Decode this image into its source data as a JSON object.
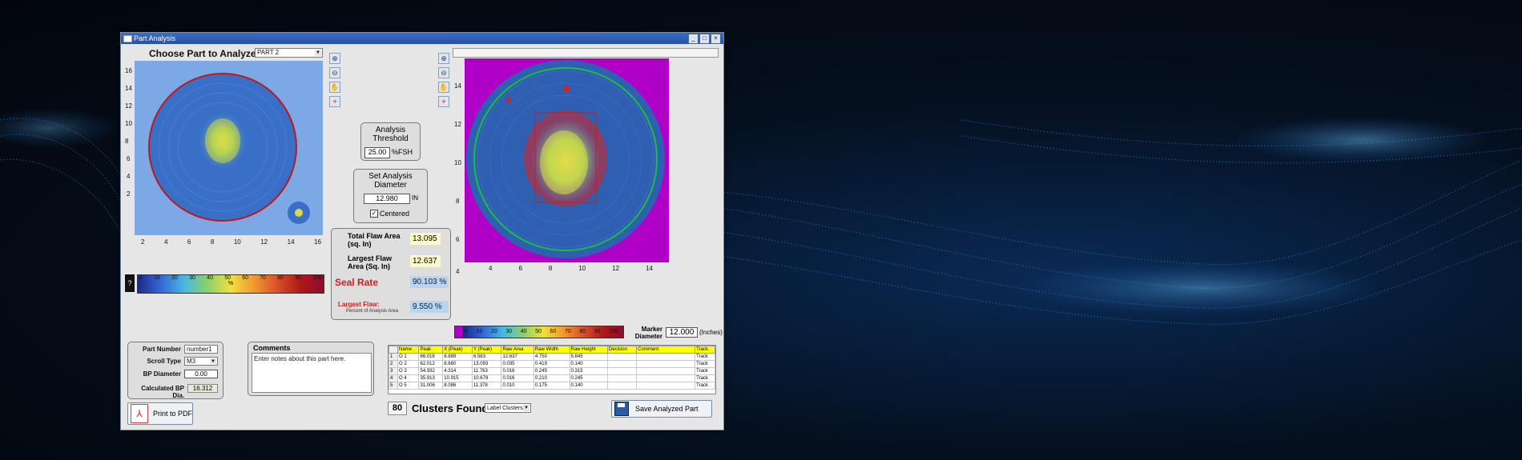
{
  "window": {
    "title": "Part Analysis"
  },
  "chooser": {
    "label": "Choose Part to Analyze:",
    "value": "PART 2"
  },
  "left_plot": {
    "y_ticks": [
      "16",
      "14",
      "12",
      "10",
      "8",
      "6",
      "4",
      "2"
    ],
    "x_ticks": [
      "2",
      "4",
      "6",
      "8",
      "10",
      "12",
      "14",
      "16"
    ]
  },
  "right_plot": {
    "y_ticks": [
      "14",
      "12",
      "10",
      "8",
      "6",
      "4"
    ],
    "x_ticks": [
      "4",
      "6",
      "8",
      "10",
      "12",
      "14"
    ]
  },
  "left_scale": {
    "help": "?",
    "ticks": [
      "0",
      "10",
      "20",
      "30",
      "40",
      "50",
      "60",
      "70",
      "80",
      "90",
      "100"
    ],
    "unit": "%"
  },
  "right_scale": {
    "ticks": [
      "0",
      "10",
      "20",
      "30",
      "40",
      "50",
      "60",
      "70",
      "80",
      "90",
      "100"
    ]
  },
  "threshold": {
    "title": "Analysis Threshold",
    "value": "25.00",
    "unit": "%FSH"
  },
  "diameter": {
    "title": "Set Analysis Diameter",
    "value": "12.980",
    "unit": "IN",
    "centered_label": "Centered",
    "centered_checked": true
  },
  "results": {
    "total_flaw_label": "Total Flaw Area (sq. In)",
    "total_flaw_value": "13.095",
    "largest_flaw_label": "Largest Flaw Area (Sq. In)",
    "largest_flaw_value": "12.637",
    "seal_rate_label": "Seal Rate",
    "seal_rate_value": "90.103 %",
    "largest_pct_label": "Largest Flaw:",
    "largest_pct_sub": "Percent of Analysis Area",
    "largest_pct_value": "9.550 %"
  },
  "marker": {
    "label": "Marker Diameter",
    "value": "12.000",
    "unit": "(Inches)"
  },
  "part_info": {
    "part_number_label": "Part Number",
    "part_number_value": "number1",
    "scroll_type_label": "Scroll Type",
    "scroll_type_value": "M3",
    "bp_diameter_label": "BP Diameter",
    "bp_diameter_value": "0.00",
    "calc_bp_label": "Calculated BP Dia.",
    "calc_bp_value": "16.312"
  },
  "comments": {
    "title": "Comments",
    "placeholder": "Enter notes about this part here."
  },
  "clusters": {
    "count": "80",
    "label": "Clusters Found",
    "label_mode": "Label Clusters",
    "columns": [
      "",
      "Name",
      "Peak",
      "X (Peak)",
      "Y (Peak)",
      "Raw Area",
      "Raw Width",
      "Raw Height",
      "Decision",
      "Comment",
      "Track"
    ],
    "rows": [
      [
        "1",
        "O 1",
        "66.016",
        "8.889",
        "6.583",
        "12.637",
        "4.750",
        "5.845",
        "",
        "",
        "Track"
      ],
      [
        "2",
        "O 2",
        "62.012",
        "8.680",
        "13.093",
        "0.035",
        "0.419",
        "0.140",
        "",
        "",
        "Track"
      ],
      [
        "3",
        "O 3",
        "54.932",
        "4.314",
        "11.763",
        "0.016",
        "0.245",
        "0.315",
        "",
        "",
        "Track"
      ],
      [
        "4",
        "O 4",
        "35.913",
        "10.915",
        "10.678",
        "0.016",
        "0.210",
        "0.245",
        "",
        "",
        "Track"
      ],
      [
        "5",
        "O 5",
        "31.006",
        "8.086",
        "11.378",
        "0.010",
        "0.175",
        "0.140",
        "",
        "",
        "Track"
      ]
    ]
  },
  "buttons": {
    "print": "Print to PDF",
    "save": "Save Analyzed Part"
  },
  "colors": {
    "magenta": "#b000c8",
    "seal_red": "#d81818",
    "scan_blue": "#2f5fb0"
  }
}
